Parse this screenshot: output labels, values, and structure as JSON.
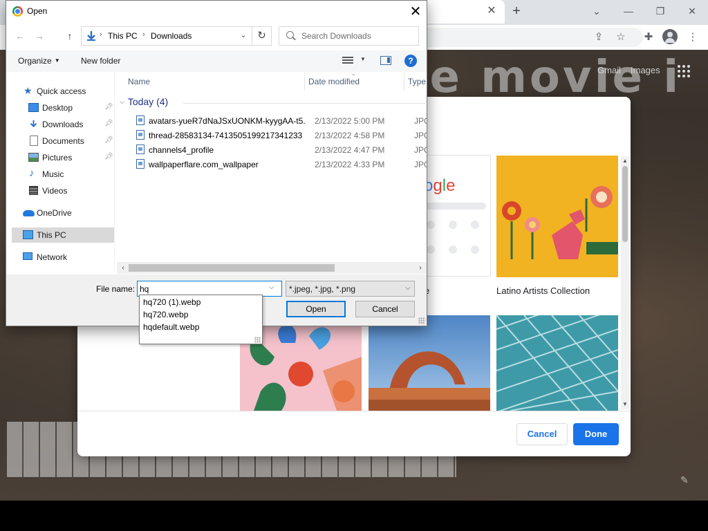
{
  "browser": {
    "ntp_links": {
      "gmail": "Gmail",
      "images": "Images"
    },
    "big_text": "ire movie i"
  },
  "customize": {
    "tiles": [
      {
        "caption": ""
      },
      {
        "caption": "Latino Artists Collection"
      }
    ],
    "cancel_label": "Cancel",
    "done_label": "Done",
    "partial_logo_text": "ogle",
    "partial_caption": "e"
  },
  "dialog": {
    "title": "Open",
    "address": {
      "segments": [
        "This PC",
        "Downloads"
      ]
    },
    "search_placeholder": "Search Downloads",
    "command_bar": {
      "organize": "Organize",
      "new_folder": "New folder"
    },
    "nav": [
      {
        "label": "Quick access",
        "icon": "star-icon",
        "pinned": false
      },
      {
        "label": "Desktop",
        "icon": "desktop-icon",
        "pinned": true
      },
      {
        "label": "Downloads",
        "icon": "download-arrow-icon",
        "pinned": true
      },
      {
        "label": "Documents",
        "icon": "document-icon",
        "pinned": true
      },
      {
        "label": "Pictures",
        "icon": "pictures-icon",
        "pinned": true
      },
      {
        "label": "Music",
        "icon": "music-note-icon",
        "pinned": false
      },
      {
        "label": "Videos",
        "icon": "film-icon",
        "pinned": false
      },
      {
        "label": "OneDrive",
        "icon": "cloud-icon",
        "pinned": false
      },
      {
        "label": "This PC",
        "icon": "computer-icon",
        "pinned": false,
        "selected": true
      },
      {
        "label": "Network",
        "icon": "network-icon",
        "pinned": false
      }
    ],
    "columns": {
      "name": "Name",
      "date": "Date modified",
      "type": "Type"
    },
    "group": {
      "label": "Today (4)"
    },
    "files": [
      {
        "name": "avatars-yueR7dNaJSxUONKM-kyygAA-t5...",
        "date": "2/13/2022 5:00 PM",
        "type": "JPG F"
      },
      {
        "name": "thread-28583134-7413505199217341233",
        "date": "2/13/2022 4:58 PM",
        "type": "JPG F"
      },
      {
        "name": "channels4_profile",
        "date": "2/13/2022 4:47 PM",
        "type": "JPG F"
      },
      {
        "name": "wallpaperflare.com_wallpaper",
        "date": "2/13/2022 4:33 PM",
        "type": "JPG F"
      }
    ],
    "file_name_label": "File name:",
    "file_name_value": "hq",
    "filter": "*.jpeg, *.jpg, *.png",
    "open_label": "Open",
    "cancel_label": "Cancel",
    "autocomplete": [
      "hq720 (1).webp",
      "hq720.webp",
      "hqdefault.webp"
    ]
  }
}
